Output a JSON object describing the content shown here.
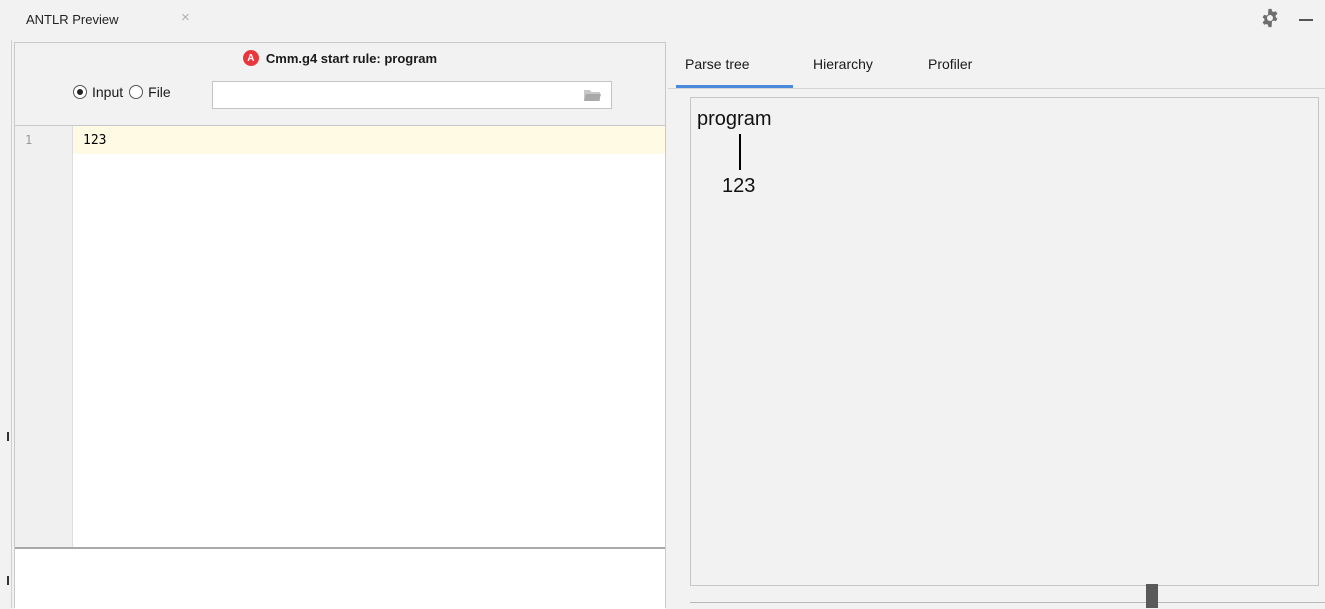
{
  "window": {
    "title": "ANTLR Preview",
    "close_glyph": "×",
    "icons": [
      "close-icon",
      "gear-icon",
      "minimize-icon"
    ]
  },
  "left_panel": {
    "grammar_icon": "A",
    "grammar_label": "Cmm.g4 start rule: program",
    "input_mode": {
      "options": [
        "Input",
        "File"
      ],
      "selected": "Input"
    },
    "file_path": {
      "value": "",
      "placeholder": ""
    },
    "editor": {
      "lines": [
        {
          "number": "1",
          "text": "123"
        }
      ]
    },
    "console_text": ""
  },
  "right_panel": {
    "tabs": [
      "Parse tree",
      "Hierarchy",
      "Profiler"
    ],
    "active_tab": "Parse tree",
    "parse_tree": {
      "root": "program",
      "children": [
        "123"
      ]
    }
  },
  "colors": {
    "accent": "#4a89dc",
    "antlr_red": "#e8383d",
    "current_line": "#fffae3"
  }
}
